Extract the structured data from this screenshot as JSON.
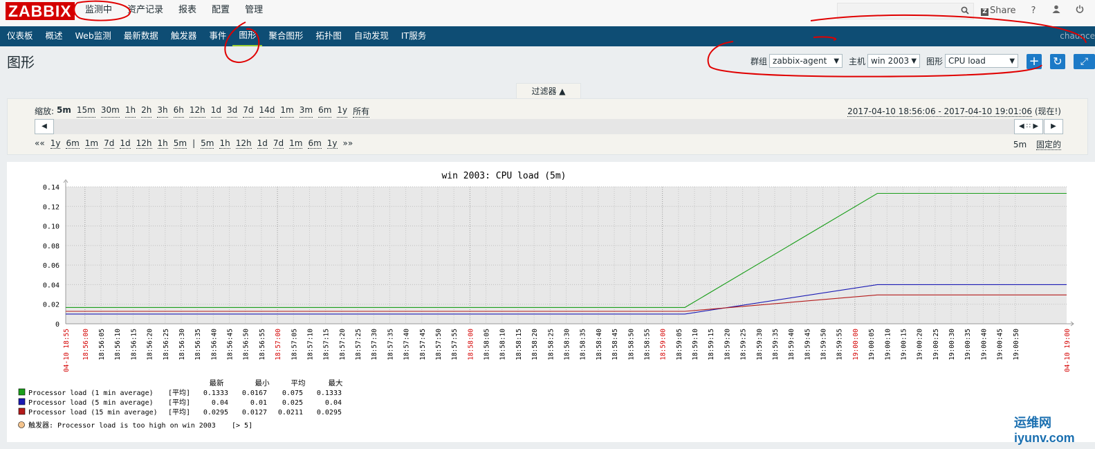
{
  "brand": {
    "logo": "ZABBIX"
  },
  "top_menu": [
    "监测中",
    "资产记录",
    "报表",
    "配置",
    "管理"
  ],
  "top_links": {
    "share": "Share",
    "help": "?"
  },
  "nav": {
    "items": [
      "仪表板",
      "概述",
      "Web监测",
      "最新数据",
      "触发器",
      "事件",
      "图形",
      "聚合图形",
      "拓扑图",
      "自动发现",
      "IT服务"
    ],
    "active": "图形",
    "user": "chaunce"
  },
  "page": {
    "title": "图形"
  },
  "controls": {
    "group_label": "群组",
    "group_value": "zabbix-agent",
    "host_label": "主机",
    "host_value": "win 2003",
    "graph_label": "图形",
    "graph_value": "CPU load",
    "add_icon": "plus-icon",
    "refresh_icon": "refresh-icon",
    "fullscreen_icon": "fullscreen-icon"
  },
  "filter": {
    "tab_label": "过滤器 ▲",
    "zoom_label": "缩放:",
    "zoom_options": [
      "5m",
      "15m",
      "30m",
      "1h",
      "2h",
      "3h",
      "6h",
      "12h",
      "1d",
      "3d",
      "7d",
      "14d",
      "1m",
      "3m",
      "6m",
      "1y",
      "所有"
    ],
    "zoom_current": "5m",
    "period_text": "2017-04-10 18:56:06 - 2017-04-10 19:01:06",
    "period_now": "(现在!)",
    "back_items": [
      "««",
      "1y",
      "6m",
      "1m",
      "7d",
      "1d",
      "12h",
      "1h",
      "5m",
      "|",
      "5m",
      "1h",
      "12h",
      "1d",
      "7d",
      "1m",
      "6m",
      "1y",
      "»»"
    ],
    "period_len": "5m",
    "fixed_label": "固定的"
  },
  "chart_data": {
    "type": "line",
    "title": "win 2003: CPU load (5m)",
    "ylim": [
      0,
      0.14
    ],
    "y_ticks": [
      "0",
      "0.02",
      "0.04",
      "0.06",
      "0.08",
      "0.10",
      "0.12",
      "0.14"
    ],
    "grid": true,
    "x_start_label": "04-10 18:55",
    "x_end_label": "04-10 19:00",
    "x_ticks": [
      "18:56:00",
      "18:56:05",
      "18:56:10",
      "18:56:15",
      "18:56:20",
      "18:56:25",
      "18:56:30",
      "18:56:35",
      "18:56:40",
      "18:56:45",
      "18:56:50",
      "18:56:55",
      "18:57:00",
      "18:57:05",
      "18:57:10",
      "18:57:15",
      "18:57:20",
      "18:57:25",
      "18:57:30",
      "18:57:35",
      "18:57:40",
      "18:57:45",
      "18:57:50",
      "18:57:55",
      "18:58:00",
      "18:58:05",
      "18:58:10",
      "18:58:15",
      "18:58:20",
      "18:58:25",
      "18:58:30",
      "18:58:35",
      "18:58:40",
      "18:58:45",
      "18:58:50",
      "18:58:55",
      "18:59:00",
      "18:59:05",
      "18:59:10",
      "18:59:15",
      "18:59:20",
      "18:59:25",
      "18:59:30",
      "18:59:35",
      "18:59:40",
      "18:59:45",
      "18:59:50",
      "18:59:55",
      "19:00:00",
      "19:00:05",
      "19:00:10",
      "19:00:15",
      "19:00:20",
      "19:00:25",
      "19:00:30",
      "19:00:35",
      "19:00:40",
      "19:00:45",
      "19:00:50"
    ],
    "red_ticks": [
      "18:56:00",
      "18:57:00",
      "18:58:00",
      "18:59:00",
      "19:00:00"
    ],
    "series": [
      {
        "name": "Processor load (1 min average)",
        "color": "#1a9e1a",
        "x": [
          "18:55:54",
          "18:59:07",
          "19:00:07",
          "19:01:06"
        ],
        "y": [
          0.0167,
          0.0167,
          0.1333,
          0.1333
        ]
      },
      {
        "name": "Processor load (5 min average)",
        "color": "#1a1ab4",
        "x": [
          "18:55:54",
          "18:59:07",
          "19:00:07",
          "19:01:06"
        ],
        "y": [
          0.01,
          0.01,
          0.04,
          0.04
        ]
      },
      {
        "name": "Processor load (15 min average)",
        "color": "#b41a1a",
        "x": [
          "18:55:54",
          "18:59:07",
          "19:00:07",
          "19:01:06"
        ],
        "y": [
          0.0127,
          0.0127,
          0.0295,
          0.0295
        ]
      }
    ],
    "legend": {
      "headers": [
        "最新",
        "最小",
        "平均",
        "最大"
      ],
      "func": "[平均]",
      "rows": [
        {
          "name": "Processor load (1 min average)",
          "color": "#1a9e1a",
          "last": "0.1333",
          "min": "0.0167",
          "avg": "0.075",
          "max": "0.1333"
        },
        {
          "name": "Processor load (5 min average)",
          "color": "#1a1ab4",
          "last": "0.04",
          "min": "0.01",
          "avg": "0.025",
          "max": "0.04"
        },
        {
          "name": "Processor load (15 min average)",
          "color": "#b41a1a",
          "last": "0.0295",
          "min": "0.0127",
          "avg": "0.0211",
          "max": "0.0295"
        }
      ],
      "trigger": "触发器: Processor load is too high on win 2003",
      "trigger_cond": "[> 5]"
    }
  },
  "watermark": {
    "text": "运维网 iyunv.com"
  }
}
